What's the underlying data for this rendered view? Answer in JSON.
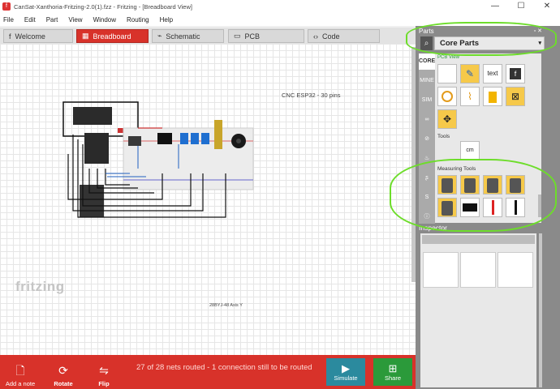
{
  "window": {
    "title": "CanSat-Xanthoria-Fritzing-2.0(1).fzz - Fritzing - [Breadboard View]",
    "controls": [
      "—",
      "☐",
      "✕"
    ]
  },
  "menu": [
    "File",
    "Edit",
    "Part",
    "View",
    "Window",
    "Routing",
    "Help"
  ],
  "tabs": [
    {
      "label": "Welcome",
      "icon": "f"
    },
    {
      "label": "Breadboard",
      "icon": "▦"
    },
    {
      "label": "Schematic",
      "icon": "⌁"
    },
    {
      "label": "PCB",
      "icon": "▭"
    },
    {
      "label": "Code",
      "icon": "‹›"
    }
  ],
  "canvas": {
    "board_label": "CNC ESP32 - 30 pins",
    "motor_label": "28BYJ-48 Axis Y",
    "logo": "fritzing"
  },
  "bottom_bar": {
    "add_note": "Add a note",
    "rotate": "Rotate",
    "flip": "Flip",
    "status": "27 of 28 nets routed - 1 connection still to be routed",
    "simulate": "Simulate",
    "share": "Share"
  },
  "parts": {
    "header": "Parts",
    "header_controls": "▫ ✕",
    "bin_title": "Core Parts",
    "bins": [
      "CORE",
      "MINE",
      "SIM",
      "∞",
      "⊘",
      "♨",
      "ʂ",
      "S",
      "ⓘ",
      "▶",
      "◐",
      "↕"
    ],
    "pcb_view_label": "PCB View",
    "tools_label": "Tools",
    "measuring_tools_label": "Measuring Tools",
    "tool_tiles": [
      "",
      "✎",
      "text",
      "f",
      "",
      "",
      "",
      "",
      "",
      ""
    ],
    "ruler_label": "cm"
  },
  "inspector": {
    "header": "Inspector"
  }
}
